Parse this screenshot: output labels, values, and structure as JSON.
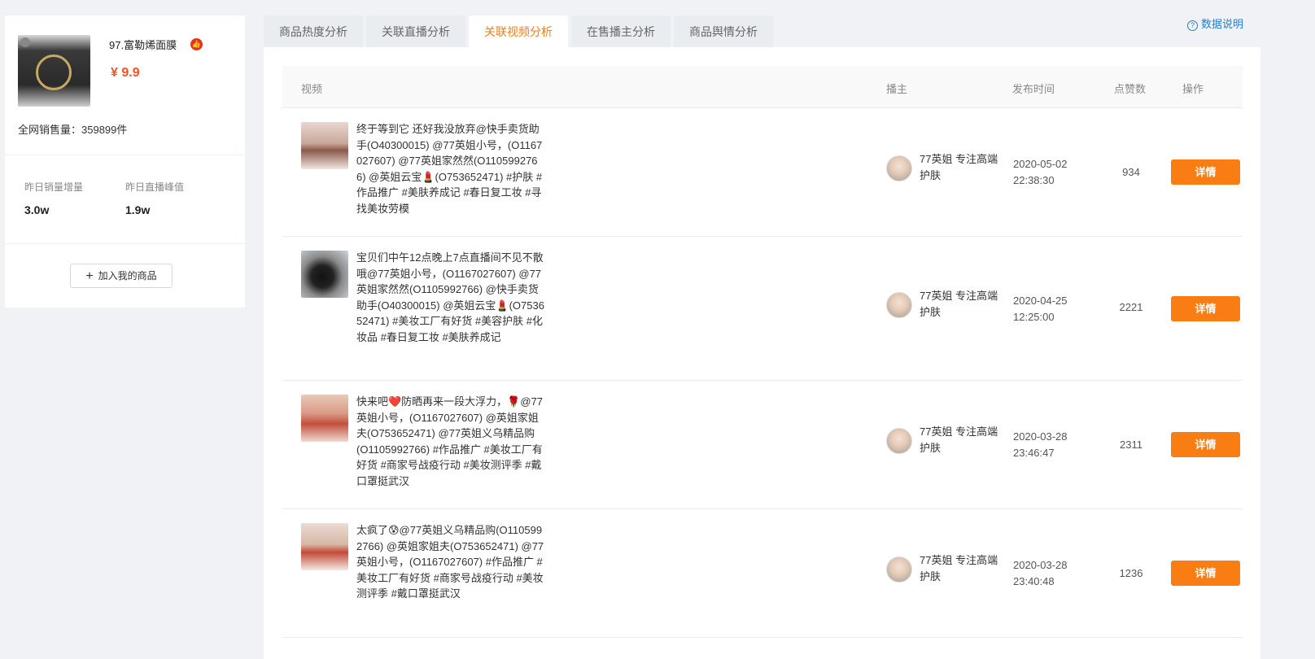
{
  "product": {
    "name": "97.富勒烯面膜",
    "hot_icon": "thumb-up-icon",
    "price": "¥ 9.9",
    "total_sales": "全网销售量：359899件",
    "stats": [
      {
        "label": "昨日销量增量",
        "value": "3.0w"
      },
      {
        "label": "昨日直播峰值",
        "value": "1.9w"
      }
    ],
    "add_button": "加入我的商品"
  },
  "tabs": [
    {
      "label": "商品热度分析",
      "active": false
    },
    {
      "label": "关联直播分析",
      "active": false
    },
    {
      "label": "关联视频分析",
      "active": true
    },
    {
      "label": "在售播主分析",
      "active": false
    },
    {
      "label": "商品舆情分析",
      "active": false
    }
  ],
  "help_label": "数据说明",
  "table": {
    "headers": {
      "video": "视频",
      "anchor": "播主",
      "time": "发布时间",
      "likes": "点赞数",
      "action": "操作"
    },
    "rows": [
      {
        "text": "终于等到它 还好我没放弃@快手卖货助手(O40300015) @77英姐小号，(O1167027607) @77英姐家然然(O1105992766) @英姐云宝💄(O753652471) #护肤 #作品推广 #美肤养成记 #春日复工妆 #寻找美妆劳模",
        "anchor": "77英姐 专注高端护肤",
        "date": "2020-05-02",
        "time": "22:38:30",
        "likes": "934",
        "action": "详情"
      },
      {
        "text": "宝贝们中午12点晚上7点直播间不见不散哦@77英姐小号，(O1167027607) @77英姐家然然(O1105992766) @快手卖货助手(O40300015) @英姐云宝💄(O753652471) #美妆工厂有好货 #美容护肤 #化妆品 #春日复工妆 #美肤养成记",
        "anchor": "77英姐 专注高端护肤",
        "date": "2020-04-25",
        "time": "12:25:00",
        "likes": "2221",
        "action": "详情"
      },
      {
        "text": "快来吧❤️防晒再来一段大浮力，🌹@77英姐小号，(O1167027607) @英姐家姐夫(O753652471) @77英姐义乌精品购(O1105992766) #作品推广 #美妆工厂有好货 #商家号战疫行动 #美妆测评季 #戴口罩挺武汉",
        "anchor": "77英姐 专注高端护肤",
        "date": "2020-03-28",
        "time": "23:46:47",
        "likes": "2311",
        "action": "详情"
      },
      {
        "text": "太疯了😰@77英姐义乌精品购(O1105992766) @英姐家姐夫(O753652471) @77英姐小号，(O1167027607) #作品推广 #美妆工厂有好货 #商家号战疫行动 #美妆测评季 #戴口罩挺武汉",
        "anchor": "77英姐 专注高端护肤",
        "date": "2020-03-28",
        "time": "23:40:48",
        "likes": "1236",
        "action": "详情"
      }
    ]
  }
}
